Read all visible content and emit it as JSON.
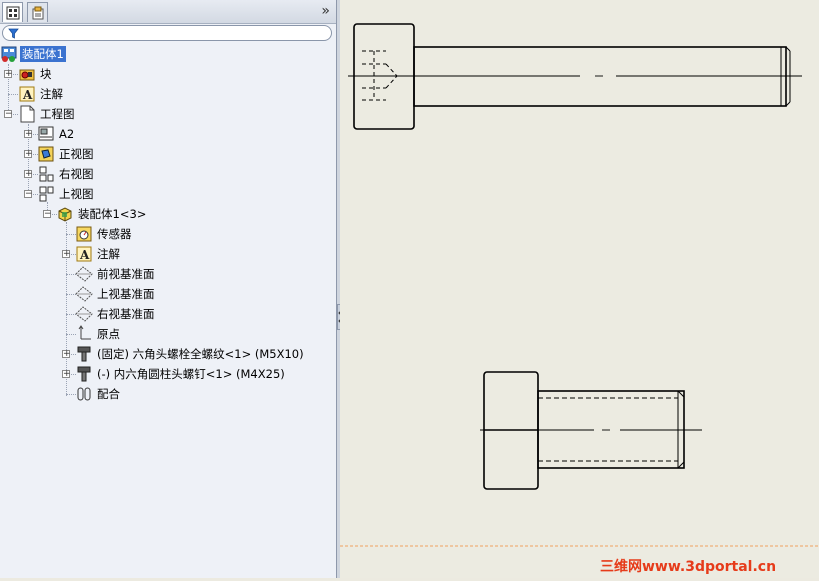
{
  "panel": {
    "tabs": [
      {
        "icon": "feature-manager-icon",
        "active": true
      },
      {
        "icon": "property-manager-icon",
        "active": false
      }
    ],
    "collapse_label": "»",
    "filter": {
      "placeholder": "",
      "icon": "filter-icon"
    }
  },
  "tree": {
    "root": "装配体1",
    "blocks": "块",
    "annotations": "注解",
    "drawing": "工程图",
    "sheet": "A2",
    "front_view": "正视图",
    "right_view": "右视图",
    "top_view": "上视图",
    "assembly_instance": "装配体1<3>",
    "sensors": "传感器",
    "sub_annotations": "注解",
    "front_plane": "前视基准面",
    "top_plane": "上视基准面",
    "right_plane": "右视基准面",
    "origin": "原点",
    "part_hex_bolt": "(固定) 六角头螺栓全螺纹<1> (M5X10)",
    "part_socket_screw": "(-) 内六角圆柱头螺钉<1> (M4X25)",
    "mates": "配合"
  },
  "watermark": "三维网www.3dportal.cn",
  "colors": {
    "selection": "#3b73d0",
    "canvas": "#ecebe1",
    "sheet_border": "#f0a060",
    "watermark": "#e63b1a"
  }
}
